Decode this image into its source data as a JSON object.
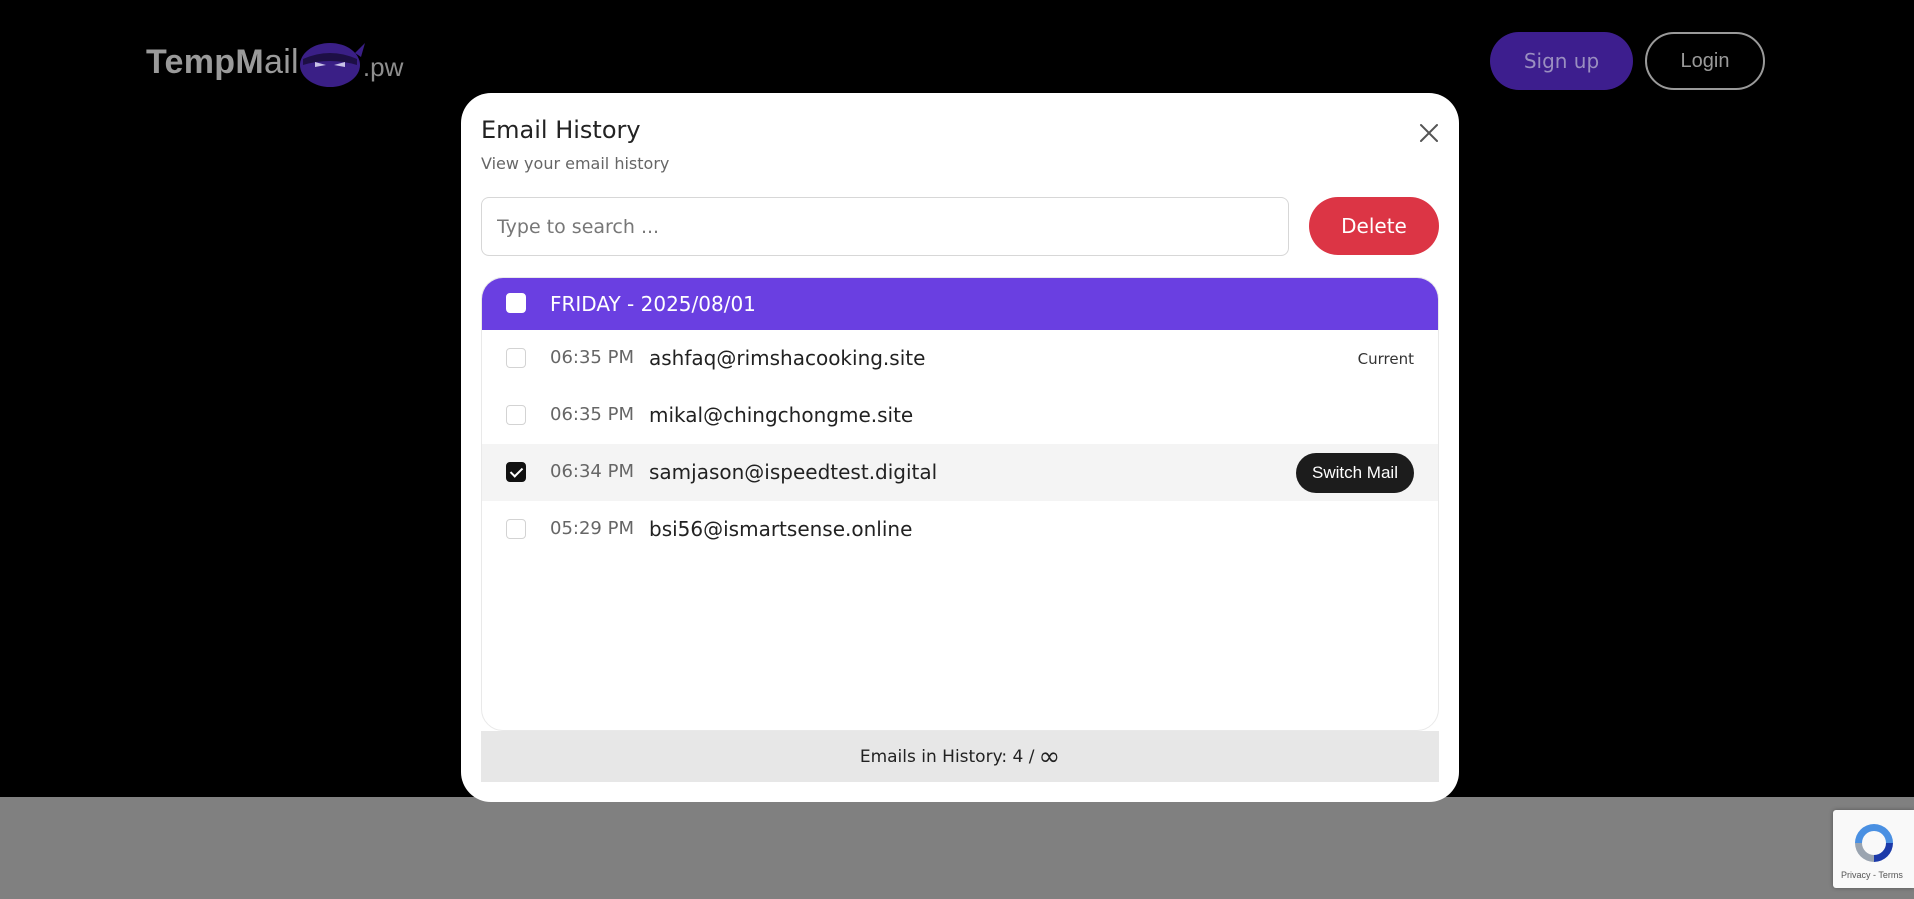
{
  "header": {
    "logo": {
      "text_bold": "TempM",
      "text_light": "ail",
      "tld": ".pw"
    },
    "signup_label": "Sign up",
    "login_label": "Login"
  },
  "modal": {
    "title": "Email History",
    "subtitle": "View your email history",
    "search_placeholder": "Type to search ...",
    "delete_label": "Delete",
    "group": {
      "label": "FRIDAY - 2025/08/01",
      "checked": false
    },
    "rows": [
      {
        "time": "06:35 PM",
        "email": "ashfaq@rimshacooking.site",
        "checked": false,
        "tag": "Current"
      },
      {
        "time": "06:35 PM",
        "email": "mikal@chingchongme.site",
        "checked": false
      },
      {
        "time": "06:34 PM",
        "email": "samjason@ispeedtest.digital",
        "checked": true,
        "action": "Switch Mail"
      },
      {
        "time": "05:29 PM",
        "email": "bsi56@ismartsense.online",
        "checked": false
      }
    ],
    "counter_label": "Emails in History: 4 /",
    "counter_symbol": "∞"
  },
  "recaptcha": {
    "links": "Privacy - Terms"
  },
  "colors": {
    "accent": "#6a3fe1",
    "delete": "#dc3545",
    "signup": "#3d1e8e"
  }
}
